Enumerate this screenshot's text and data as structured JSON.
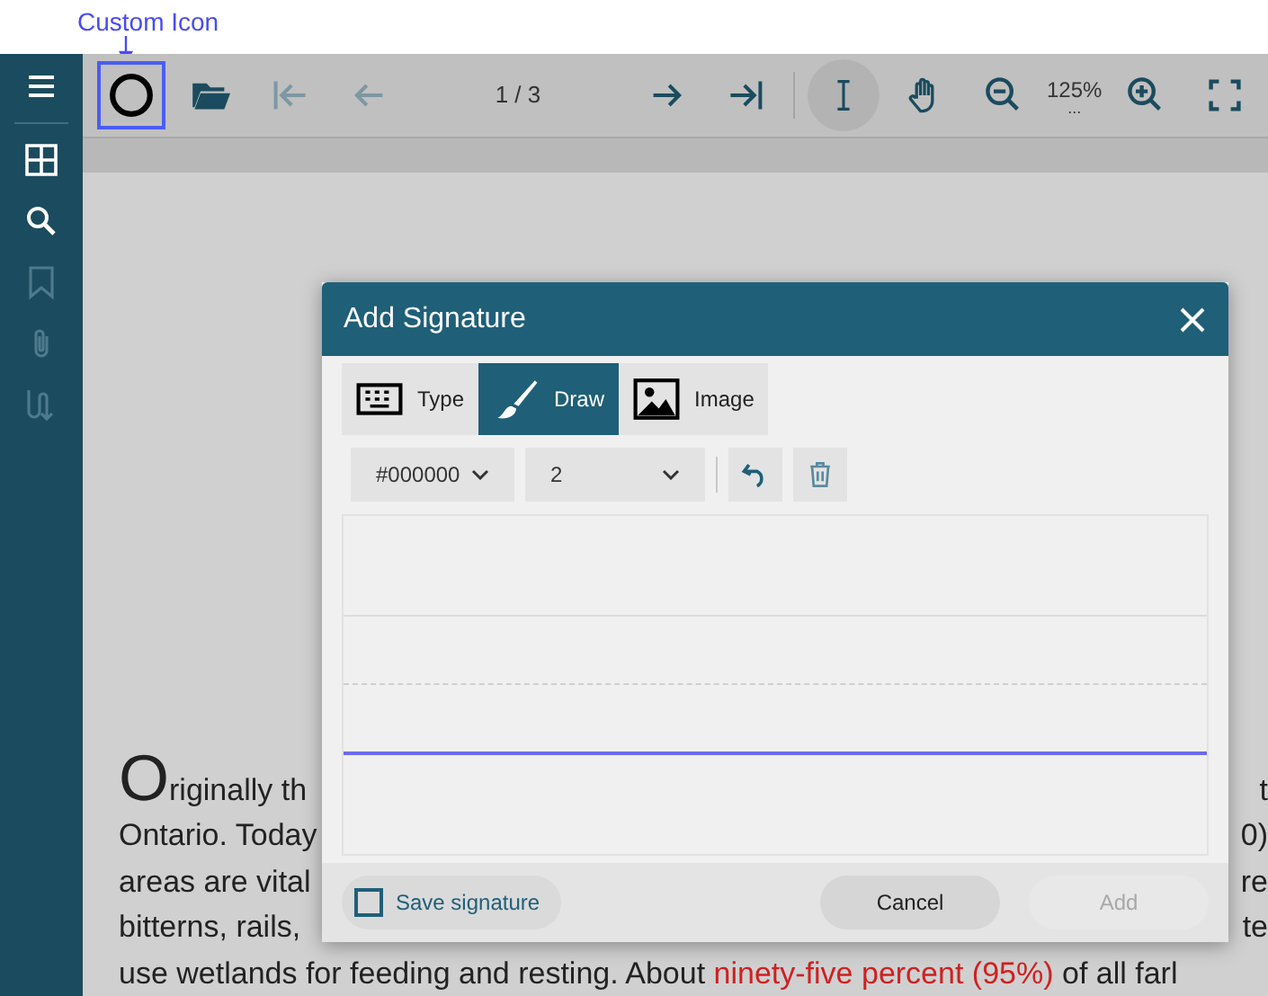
{
  "annotation": {
    "label": "Custom Icon"
  },
  "sidebar": {
    "items": [
      {
        "disabled": false
      },
      {
        "disabled": false
      },
      {
        "disabled": false
      },
      {
        "disabled": true
      },
      {
        "disabled": true
      },
      {
        "disabled": true
      }
    ]
  },
  "toolbar": {
    "items": [
      {
        "kind": "icon",
        "disabled": false,
        "selected": true
      },
      {
        "kind": "icon",
        "disabled": false,
        "selected": false
      },
      {
        "kind": "icon",
        "disabled": true,
        "selected": false
      },
      {
        "kind": "icon",
        "disabled": true,
        "selected": false
      },
      {
        "kind": "text",
        "text": "1 / 3"
      },
      {
        "kind": "icon",
        "disabled": false,
        "selected": false
      },
      {
        "kind": "icon",
        "disabled": false,
        "selected": false
      },
      {
        "kind": "separator"
      },
      {
        "kind": "icon",
        "disabled": false,
        "selected": true
      },
      {
        "kind": "icon",
        "disabled": false,
        "selected": false
      },
      {
        "kind": "icon",
        "disabled": false,
        "selected": false
      },
      {
        "kind": "zoom",
        "text": "125%",
        "sub": "..."
      },
      {
        "kind": "icon",
        "disabled": false,
        "selected": false
      },
      {
        "kind": "icon",
        "disabled": false,
        "selected": false
      }
    ]
  },
  "document": {
    "lines": [
      {
        "left": "Originally th",
        "right": "t"
      },
      {
        "left": "Ontario. Today",
        "right": "0)"
      },
      {
        "left": "areas are vital",
        "right": "re"
      },
      {
        "left": "bitterns, rails,",
        "right": "te"
      },
      {
        "left": "use wetlands for feeding and resting. About **ninety-five percent (95%)** of all farl"
      }
    ]
  },
  "dialog": {
    "title": "Add Signature",
    "tabs": [
      {
        "label": "Type",
        "selected": false
      },
      {
        "label": "Draw",
        "selected": true
      },
      {
        "label": "Image",
        "selected": false
      }
    ],
    "color_select": {
      "value": "#000000"
    },
    "width_select": {
      "value": "2"
    },
    "save_signature": {
      "label": "Save signature",
      "checked": false
    },
    "buttons": [
      {
        "label": "Cancel",
        "disabled": false
      },
      {
        "label": "Add",
        "disabled": true
      }
    ]
  }
}
